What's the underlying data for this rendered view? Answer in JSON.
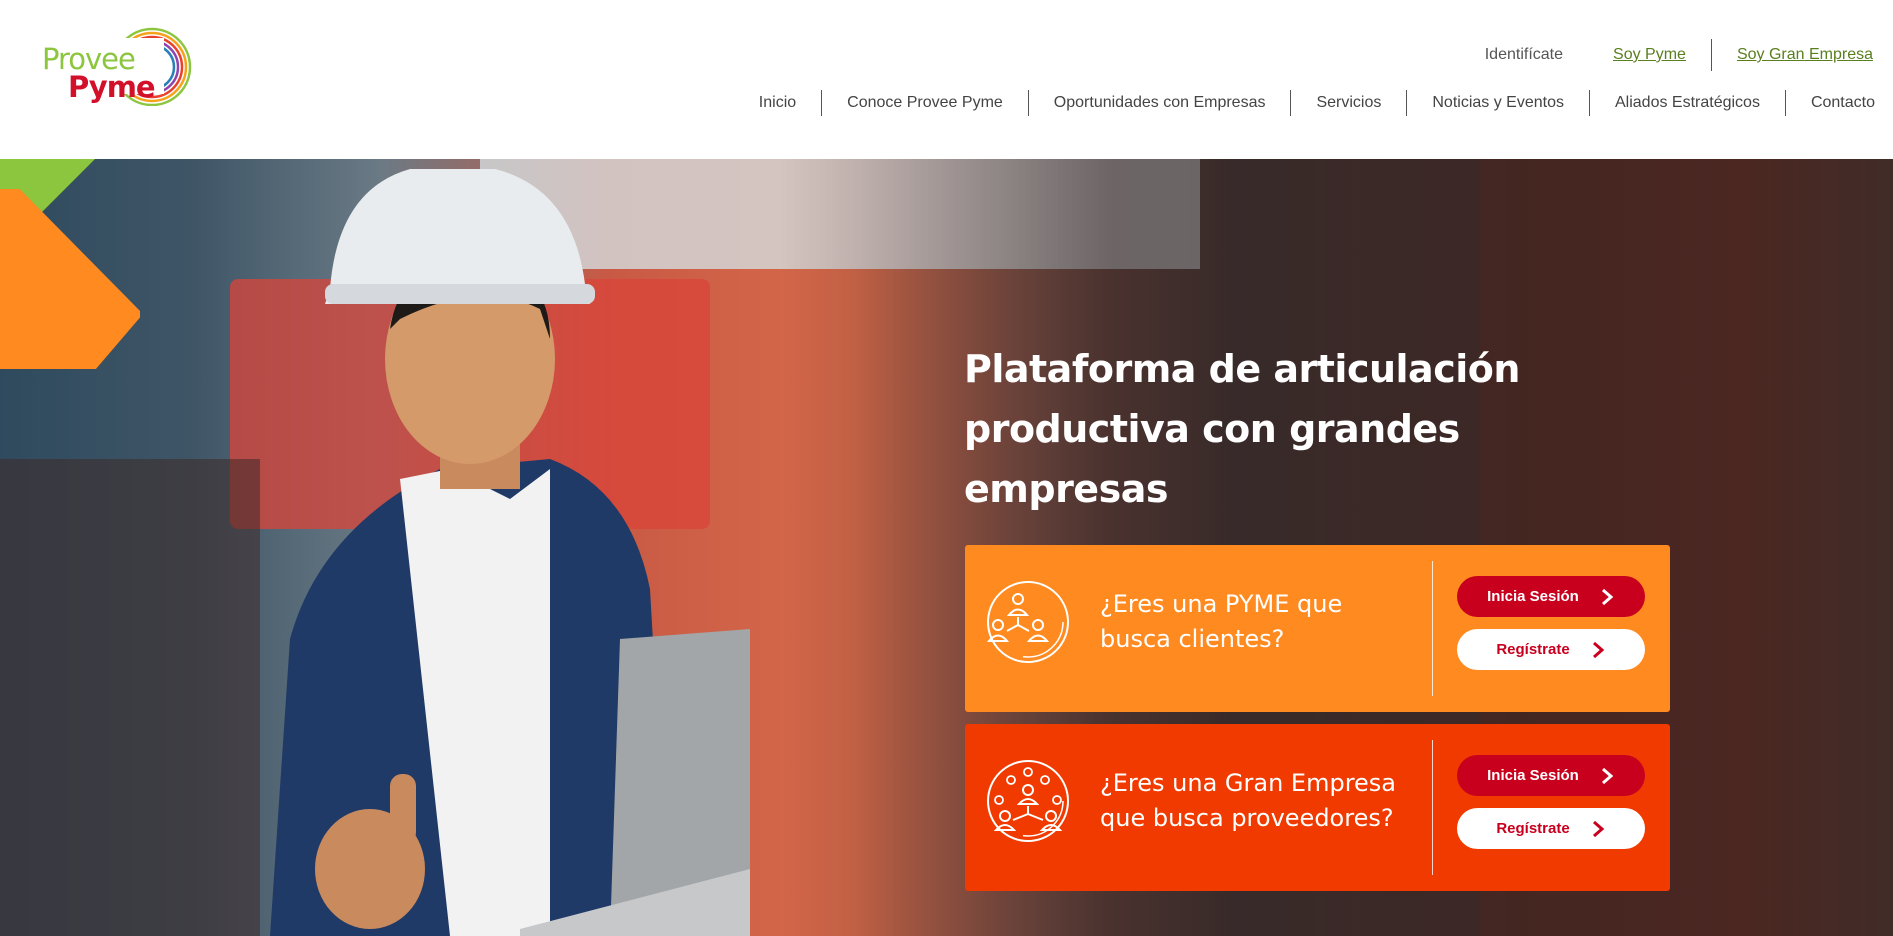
{
  "logo": {
    "line1": "Provee",
    "line2": "Pyme"
  },
  "toplinks": {
    "identificate": "Identifícate",
    "soy_pyme": "Soy Pyme",
    "soy_gran_empresa": "Soy Gran Empresa"
  },
  "nav": {
    "items": [
      {
        "label": "Inicio"
      },
      {
        "label": "Conoce Provee Pyme"
      },
      {
        "label": "Oportunidades con Empresas"
      },
      {
        "label": "Servicios"
      },
      {
        "label": "Noticias y Eventos"
      },
      {
        "label": "Aliados Estratégicos"
      },
      {
        "label": "Contacto"
      }
    ]
  },
  "hero": {
    "headline": "Plataforma de articulación productiva con grandes empresas"
  },
  "cards": [
    {
      "question": "¿Eres una PYME que busca clientes?",
      "icon": "people-network-icon",
      "login_label": "Inicia Sesión",
      "register_label": "Regístrate"
    },
    {
      "question": "¿Eres una Gran Empresa que busca proveedores?",
      "icon": "large-network-icon",
      "login_label": "Inicia Sesión",
      "register_label": "Regístrate"
    }
  ],
  "colors": {
    "brand_green": "#8cc63f",
    "brand_red": "#d3102a",
    "card_orange": "#ff8a1f",
    "card_red_orange": "#f03a00",
    "button_red": "#c8001e"
  }
}
